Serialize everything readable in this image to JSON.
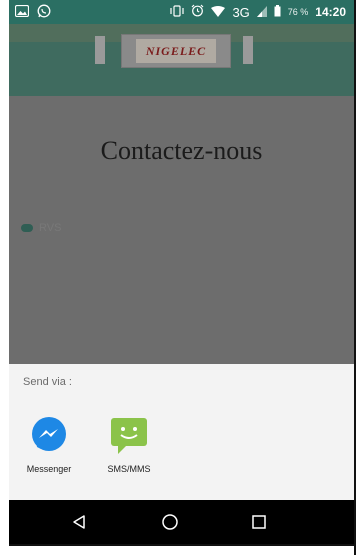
{
  "status_bar": {
    "battery_percent": "76 %",
    "network": "3G",
    "time": "14:20",
    "icons": [
      "gallery-icon",
      "whatsapp-icon",
      "vibrate-icon",
      "alarm-icon",
      "wifi-icon",
      "signal-icon",
      "battery-icon"
    ]
  },
  "header": {
    "logo_text": "NIGELEC"
  },
  "page": {
    "title": "Contactez-nous",
    "rdv_label": "RVS"
  },
  "share_sheet": {
    "title": "Send via :",
    "targets": [
      {
        "label": "Messenger",
        "icon": "messenger-icon",
        "color": "#1e88e5"
      },
      {
        "label": "SMS/MMS",
        "icon": "sms-icon",
        "color": "#8bc34a"
      }
    ]
  },
  "nav_bar": {
    "buttons": [
      "back-icon",
      "home-icon",
      "recents-icon"
    ]
  },
  "colors": {
    "status_bar": "#2b6f63",
    "overlay": "#6b6b6b",
    "sheet_bg": "#f3f3f3",
    "nav_bg": "#000000"
  }
}
